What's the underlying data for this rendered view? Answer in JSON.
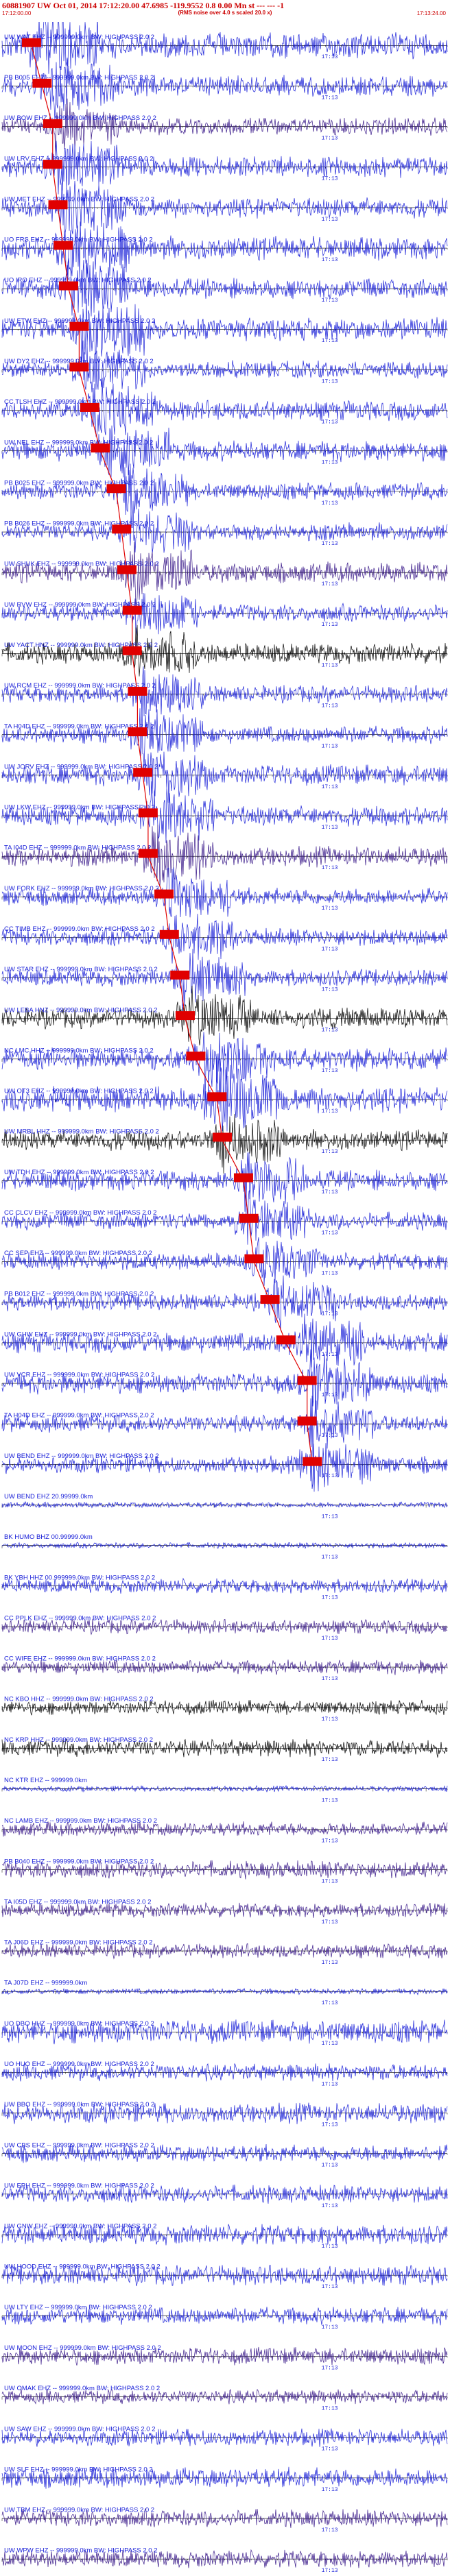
{
  "header": {
    "title": "60881907 UW Oct 01, 2014 17:12:20.00   47.6985 -119.9552  0.8 0.00 Mn st --- --- -1",
    "start_time": "17:12:00.00",
    "end_time": "17:13:24.00",
    "noise_note": "(RMS noise over 4.0 s scaled 20.0 x)"
  },
  "colors": {
    "pick": "#e00000",
    "pick_line": "#e00000",
    "axis": "#000000"
  },
  "chart_data": {
    "type": "seismogram",
    "x_range_seconds": [
      0,
      84
    ],
    "scale_label": "17:13",
    "scale_time_seconds": 60,
    "traces": [
      {
        "label": "UW WAT EHZ -- 999999.0km BW: HIGHPASS 2.0 2",
        "color": "#1a20d8",
        "amp": 0.45,
        "pick": 4,
        "event": 6
      },
      {
        "label": "PB B005 EHZ -- 999999.0km BW: HIGHPASS 2.0 2",
        "color": "#1a20d8",
        "amp": 0.35,
        "pick": 6,
        "event": 9
      },
      {
        "label": "UW BOW EHZ -- 999999.0km BW: HIGHPASS 2.0 2",
        "color": "#3a1a8a",
        "amp": 0.3,
        "pick": 8,
        "event": 10
      },
      {
        "label": "UW LRV EHZ -- 999999.0km BW: HIGHPASS 2.0 2",
        "color": "#1a20d8",
        "amp": 0.35,
        "pick": 8,
        "event": 10
      },
      {
        "label": "UW MET EHZ -- 999999.0km BW: HIGHPASS 2.0 2",
        "color": "#1a20d8",
        "amp": 0.35,
        "pick": 9,
        "event": 11
      },
      {
        "label": "UO FRS EHZ -- 999999.0km BW: HIGHPASS 2.0 2",
        "color": "#1a20d8",
        "amp": 0.4,
        "pick": 10,
        "event": 12
      },
      {
        "label": "UO IRO EHZ -- 999999.0km BW: HIGHPASS 2.0 2",
        "color": "#1a20d8",
        "amp": 0.35,
        "pick": 11,
        "event": 12
      },
      {
        "label": "UW ETW EHZ -- 999999.0km BW: HIGHPASS 2.0 2",
        "color": "#1a20d8",
        "amp": 0.4,
        "pick": 13,
        "event": 15
      },
      {
        "label": "UW DY2 EHZ -- 999999.0km BW: HIGHPASS 2.0 2",
        "color": "#1a20d8",
        "amp": 0.3,
        "pick": 13,
        "event": 15
      },
      {
        "label": "CC TLSH EHZ -- 999999.0km BW: HIGHPASS 2.0 2",
        "color": "#1a20d8",
        "amp": 0.35,
        "pick": 15,
        "event": 17
      },
      {
        "label": "UW NEL EHZ -- 999999.0km BW: HIGHPASS 2.0 2",
        "color": "#1a20d8",
        "amp": 0.35,
        "pick": 17,
        "event": 20
      },
      {
        "label": "PB B025 EHZ -- 999999.0km BW: HIGHPASS 2.0 2",
        "color": "#1a20d8",
        "amp": 0.3,
        "pick": 20,
        "event": 23
      },
      {
        "label": "PB B026 EHZ -- 999999.0km BW: HIGHPASS 2.0 2",
        "color": "#1a20d8",
        "amp": 0.3,
        "pick": 21,
        "event": 24
      },
      {
        "label": "UW SHUK EHZ -- 999999.0km BW: HIGHPASS 2.0 2",
        "color": "#3a1a8a",
        "amp": 0.35,
        "pick": 22,
        "event": 24
      },
      {
        "label": "UW RVW EHZ -- 999999.0km BW: HIGHPASS 2.0 2",
        "color": "#1a20d8",
        "amp": 0.3,
        "pick": 23,
        "event": 25
      },
      {
        "label": "UW YACT HNZ -- 999999.0km BW: HIGHPASS 2.0 2",
        "color": "#000000",
        "amp": 0.35,
        "pick": 23,
        "event": 25
      },
      {
        "label": "UW RCM EHZ -- 999999.0km BW: HIGHPASS 2.0 2",
        "color": "#1a20d8",
        "amp": 0.3,
        "pick": 24,
        "event": 26
      },
      {
        "label": "TA H04D EHZ -- 999999.0km BW: HIGHPASS 2.0 2",
        "color": "#1a20d8",
        "amp": 0.3,
        "pick": 24,
        "event": 26
      },
      {
        "label": "UW JORV EHZ -- 999999.0km BW: HIGHPASS 2.0 2",
        "color": "#1a20d8",
        "amp": 0.35,
        "pick": 25,
        "event": 27
      },
      {
        "label": "UW LKW EHZ -- 999999.0km BW: HIGHPASS 2.0 2",
        "color": "#1a20d8",
        "amp": 0.35,
        "pick": 26,
        "event": 28
      },
      {
        "label": "TA I04D EHZ -- 999999.0km BW: HIGHPASS 2.0 2",
        "color": "#3a1a8a",
        "amp": 0.35,
        "pick": 26,
        "event": 28
      },
      {
        "label": "UW FORK EHZ -- 999999.0km BW: HIGHPASS 2.0 2",
        "color": "#1a20d8",
        "amp": 0.3,
        "pick": 29,
        "event": 31
      },
      {
        "label": "CC TIMB EHZ -- 999999.0km BW: HIGHPASS 2.0 2",
        "color": "#1a20d8",
        "amp": 0.3,
        "pick": 30,
        "event": 32
      },
      {
        "label": "UW STAR EHZ -- 999999.0km BW: HIGHPASS 2.0 2",
        "color": "#1a20d8",
        "amp": 0.3,
        "pick": 32,
        "event": 34
      },
      {
        "label": "UW LEBA HNZ -- 999999.0km BW: HIGHPASS 2.0 2",
        "color": "#000000",
        "amp": 0.35,
        "pick": 33,
        "event": 35
      },
      {
        "label": "NC LMC HHZ -- 999999.0km BW: HIGHPASS 2.0 2",
        "color": "#1a20d8",
        "amp": 0.4,
        "pick": 35,
        "event": 38
      },
      {
        "label": "UW OT3 EHZ -- 999999.0km BW: HIGHPASS 2.0 2",
        "color": "#1a20d8",
        "amp": 0.45,
        "pick": 39,
        "event": 40
      },
      {
        "label": "UW MRBL HHZ -- 999999.0km BW: HIGHPASS 2.0 2",
        "color": "#000000",
        "amp": 0.35,
        "pick": 40,
        "event": 41
      },
      {
        "label": "UW TDH EHZ -- 999999.0km BW: HIGHPASS 2.0 2",
        "color": "#1a20d8",
        "amp": 0.35,
        "pick": 44,
        "event": 45
      },
      {
        "label": "CC CLCV EHZ -- 999999.0km BW: HIGHPASS 2.0 2",
        "color": "#1a20d8",
        "amp": 0.3,
        "pick": 45,
        "event": 46
      },
      {
        "label": "CC SEP EHZ -- 999999.0km BW: HIGHPASS 2.0 2",
        "color": "#1a20d8",
        "amp": 0.3,
        "pick": 46,
        "event": 48
      },
      {
        "label": "PB B012 EHZ -- 999999.0km BW: HIGHPASS 2.0 2",
        "color": "#1a20d8",
        "amp": 0.3,
        "pick": 49,
        "event": 51
      },
      {
        "label": "UW GHW EHZ -- 999999.0km BW: HIGHPASS 2.0 2",
        "color": "#1a20d8",
        "amp": 0.35,
        "pick": 52,
        "event": 56
      },
      {
        "label": "UW VCR EHZ -- 999999.0km BW: HIGHPASS 2.0 2",
        "color": "#1a20d8",
        "amp": 0.35,
        "pick": 56,
        "event": 58
      },
      {
        "label": "TA H04D EHZ -- 999999.0km BW: HIGHPASS 2.0 2",
        "color": "#1a20d8",
        "amp": 0.3,
        "pick": 56,
        "event": 58
      },
      {
        "label": "UW BEND EHZ -- 999999.0km BW: HIGHPASS 2.0 2",
        "color": "#1a20d8",
        "amp": 0.3,
        "pick": 57,
        "event": 58
      },
      {
        "label": "UW BEND EHZ 20.99999.0km",
        "color": "#1a20d8",
        "amp": 0.1,
        "pick": null,
        "event": null
      },
      {
        "label": "BK HUMO BHZ 00.99999.0km",
        "color": "#1a20d8",
        "amp": 0.1,
        "pick": null,
        "event": null
      },
      {
        "label": "BK YBH HHZ 00.999999.0km BW: HIGHPASS 2.0 2",
        "color": "#1a20d8",
        "amp": 0.25,
        "pick": null,
        "event": null
      },
      {
        "label": "CC PPLK EHZ -- 999999.0km BW: HIGHPASS 2.0 2",
        "color": "#3a1a8a",
        "amp": 0.25,
        "pick": null,
        "event": null
      },
      {
        "label": "CC WIFE EHZ -- 999999.0km BW: HIGHPASS 2.0 2",
        "color": "#3a1a8a",
        "amp": 0.25,
        "pick": null,
        "event": null
      },
      {
        "label": "NC KBO HHZ -- 999999.0km BW: HIGHPASS 2.0 2",
        "color": "#000000",
        "amp": 0.25,
        "pick": null,
        "event": null
      },
      {
        "label": "NC KRP HHZ -- 999999.0km BW: HIGHPASS 2.0 2",
        "color": "#000000",
        "amp": 0.3,
        "pick": null,
        "event": null
      },
      {
        "label": "NC KTR EHZ -- 999999.0km",
        "color": "#1a20d8",
        "amp": 0.1,
        "pick": null,
        "event": null
      },
      {
        "label": "NC LAMB EHZ -- 999999.0km BW: HIGHPASS 2.0 2",
        "color": "#3a1a8a",
        "amp": 0.25,
        "pick": null,
        "event": null
      },
      {
        "label": "PB B040 EHZ -- 999999.0km BW: HIGHPASS 2.0 2",
        "color": "#3a1a8a",
        "amp": 0.3,
        "pick": null,
        "event": null
      },
      {
        "label": "TA I05D EHZ -- 999999.0km BW: HIGHPASS 2.0 2",
        "color": "#3a1a8a",
        "amp": 0.25,
        "pick": null,
        "event": null
      },
      {
        "label": "TA J06D EHZ -- 999999.0km BW: HIGHPASS 2.0 2",
        "color": "#3a1a8a",
        "amp": 0.25,
        "pick": null,
        "event": null
      },
      {
        "label": "TA J07D EHZ -- 999999.0km",
        "color": "#1a20d8",
        "amp": 0.1,
        "pick": null,
        "event": null
      },
      {
        "label": "UO DBO HHZ -- 999999.0km BW: HIGHPASS 2.0 2",
        "color": "#1a20d8",
        "amp": 0.4,
        "pick": null,
        "event": null
      },
      {
        "label": "UO HUO EHZ -- 999999.0km BW: HIGHPASS 2.0 2",
        "color": "#1a20d8",
        "amp": 0.3,
        "pick": null,
        "event": null
      },
      {
        "label": "UW BBO EHZ -- 999999.0km BW: HIGHPASS 2.0 2",
        "color": "#1a20d8",
        "amp": 0.35,
        "pick": null,
        "event": null
      },
      {
        "label": "UW CBS EHZ -- 999999.0km BW: HIGHPASS 2.0 2",
        "color": "#1a20d8",
        "amp": 0.3,
        "pick": null,
        "event": null
      },
      {
        "label": "UW EPH EHZ -- 999999.0km BW: HIGHPASS 2.0 2",
        "color": "#1a20d8",
        "amp": 0.3,
        "pick": null,
        "event": null
      },
      {
        "label": "UW GNW EHZ -- 999999.0km BW: HIGHPASS 2.0 2",
        "color": "#1a20d8",
        "amp": 0.35,
        "pick": null,
        "event": null
      },
      {
        "label": "UW HOOD EHZ -- 999999.0km BW: HIGHPASS 2.0 2",
        "color": "#1a20d8",
        "amp": 0.35,
        "pick": null,
        "event": null
      },
      {
        "label": "UW LTY EHZ -- 999999.0km BW: HIGHPASS 2.0 2",
        "color": "#1a20d8",
        "amp": 0.3,
        "pick": null,
        "event": null
      },
      {
        "label": "UW MOON EHZ -- 999999.0km BW: HIGHPASS 2.0 2",
        "color": "#3a1a8a",
        "amp": 0.3,
        "pick": null,
        "event": null
      },
      {
        "label": "UW OMAK EHZ -- 999999.0km BW: HIGHPASS 2.0 2",
        "color": "#3a1a8a",
        "amp": 0.25,
        "pick": null,
        "event": null
      },
      {
        "label": "UW SAW EHZ -- 999999.0km BW: HIGHPASS 2.0 2",
        "color": "#1a20d8",
        "amp": 0.3,
        "pick": null,
        "event": null
      },
      {
        "label": "UW SLF EHZ -- 999999.0km BW: HIGHPASS 2.0 2",
        "color": "#1a20d8",
        "amp": 0.35,
        "pick": null,
        "event": null
      },
      {
        "label": "UW TBM EHZ -- 999999.0km BW: HIGHPASS 2.0 2",
        "color": "#3a1a8a",
        "amp": 0.3,
        "pick": null,
        "event": null
      },
      {
        "label": "UW WPW EHZ -- 999999.0km BW: HIGHPASS 2.0 2",
        "color": "#3a1a8a",
        "amp": 0.3,
        "pick": null,
        "event": null
      }
    ]
  }
}
